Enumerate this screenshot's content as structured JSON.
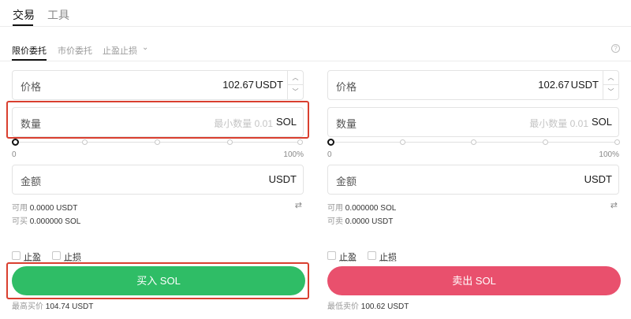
{
  "top_tabs": [
    {
      "label": "交易",
      "active": true
    },
    {
      "label": "工具",
      "active": false
    }
  ],
  "order_tabs": [
    {
      "label": "限价委托",
      "active": true
    },
    {
      "label": "市价委托",
      "active": false
    },
    {
      "label": "止盈止损",
      "active": false
    }
  ],
  "order_tab_chevron": "⌄",
  "help_glyph": "?",
  "buy": {
    "price": {
      "label": "价格",
      "value": "102.67",
      "unit": "USDT"
    },
    "amount": {
      "label": "数量",
      "placeholder": "最小数量 0.01",
      "unit": "SOL"
    },
    "slider": {
      "min_label": "0",
      "max_label": "100%",
      "value_percent": 0
    },
    "total": {
      "label": "金额",
      "unit": "USDT"
    },
    "available": {
      "label": "可用",
      "value": "0.0000 USDT"
    },
    "can_trade": {
      "label": "可买",
      "value": "0.000000 SOL"
    },
    "take_profit_label": "止盈",
    "stop_loss_label": "止损",
    "button_label": "买入 SOL",
    "best_price": {
      "label": "最高买价",
      "value": "104.74 USDT"
    }
  },
  "sell": {
    "price": {
      "label": "价格",
      "value": "102.67",
      "unit": "USDT"
    },
    "amount": {
      "label": "数量",
      "placeholder": "最小数量 0.01",
      "unit": "SOL"
    },
    "slider": {
      "min_label": "0",
      "max_label": "100%",
      "value_percent": 0
    },
    "total": {
      "label": "金额",
      "unit": "USDT"
    },
    "available": {
      "label": "可用",
      "value": "0.000000 SOL"
    },
    "can_trade": {
      "label": "可卖",
      "value": "0.0000 USDT"
    },
    "take_profit_label": "止盈",
    "stop_loss_label": "止损",
    "button_label": "卖出 SOL",
    "best_price": {
      "label": "最低卖价",
      "value": "100.62 USDT"
    }
  },
  "icons": {
    "stepper_up": "︿",
    "stepper_down": "﹀",
    "swap": "⇄"
  },
  "colors": {
    "buy": "#2fbd66",
    "sell": "#e9506d",
    "highlight": "#d93f2f"
  }
}
